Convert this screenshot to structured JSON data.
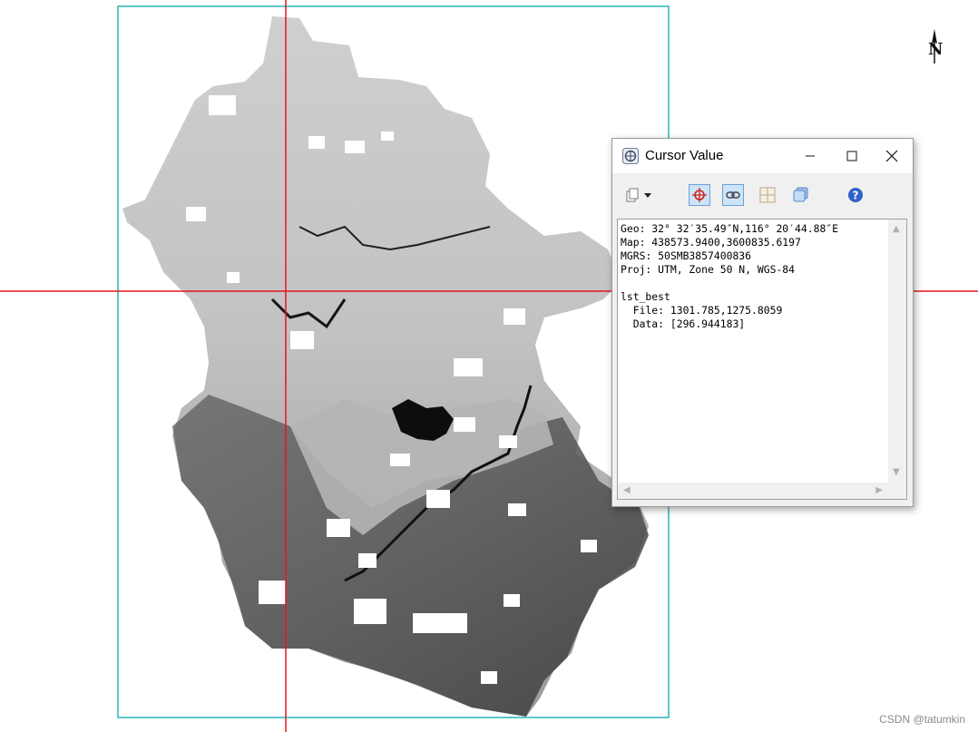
{
  "map": {
    "extent_frame_color": "#29b6b6",
    "crosshair_color": "#e8141d",
    "north_arrow_label": "N"
  },
  "cursor_window": {
    "title": "Cursor Value",
    "controls": {
      "minimize": "minimize-icon",
      "maximize": "maximize-icon",
      "close": "close-icon"
    },
    "toolbar": [
      {
        "name": "copy-icon",
        "active": false
      },
      {
        "name": "dropdown-arrow-icon",
        "active": false
      },
      {
        "name": "crosshair-icon",
        "active": true
      },
      {
        "name": "link-icon",
        "active": true
      },
      {
        "name": "grid-icon",
        "active": false
      },
      {
        "name": "layers-icon",
        "active": false
      },
      {
        "name": "help-icon",
        "active": false
      }
    ],
    "info_lines": [
      "Geo: 32° 32′35.49″N,116° 20′44.88″E",
      "Map: 438573.9400,3600835.6197",
      "MGRS: 50SMB3857400836",
      "Proj: UTM, Zone 50 N, WGS-84",
      "",
      "lst_best",
      "  File: 1301.785,1275.8059",
      "  Data: [296.944183]"
    ]
  },
  "watermark": "CSDN @tatumkin"
}
